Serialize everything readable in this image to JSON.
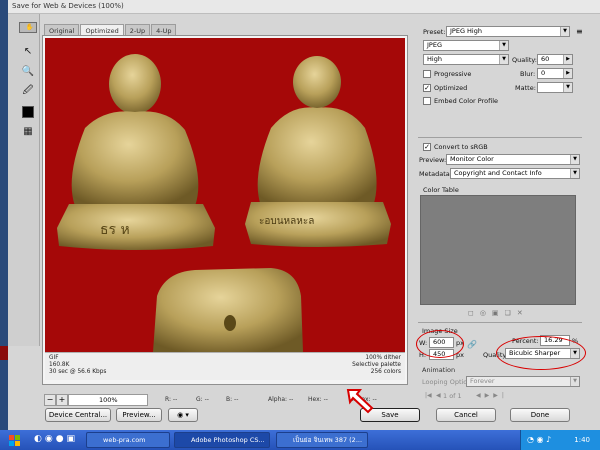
{
  "window": {
    "title": "Save for Web & Devices (100%)"
  },
  "tabs": [
    {
      "label": "Original"
    },
    {
      "label": "Optimized"
    },
    {
      "label": "2-Up"
    },
    {
      "label": "4-Up"
    }
  ],
  "preview_info": {
    "format": "GIF",
    "size": "160.8K",
    "time": "30 sec @ 56.6 Kbps",
    "dither": "100% dither",
    "palette": "Selective palette",
    "colors": "256 colors"
  },
  "bottom": {
    "zoom": "100%",
    "r_label": "R: --",
    "g_label": "G: --",
    "b_label": "B: --",
    "alpha_label": "Alpha: --",
    "hex_label": "Hex: --",
    "index_label": "Index: --"
  },
  "buttons": {
    "device_central": "Device Central...",
    "preview": "Preview...",
    "save": "Save",
    "cancel": "Cancel",
    "done": "Done"
  },
  "settings": {
    "preset_label": "Preset:",
    "preset_value": "JPEG High",
    "format_value": "JPEG",
    "quality_level": "High",
    "quality_label": "Quality:",
    "quality_value": "60",
    "progressive_label": "Progressive",
    "blur_label": "Blur:",
    "blur_value": "0",
    "optimized_label": "Optimized",
    "matte_label": "Matte:",
    "embed_profile_label": "Embed Color Profile",
    "convert_srgb_label": "Convert to sRGB",
    "preview_label": "Preview:",
    "preview_value": "Monitor Color",
    "metadata_label": "Metadata:",
    "metadata_value": "Copyright and Contact Info",
    "color_table_label": "Color Table"
  },
  "image_size": {
    "section_label": "Image Size",
    "w_label": "W:",
    "w_value": "600",
    "h_label": "H:",
    "h_value": "450",
    "unit": "px",
    "percent_label": "Percent:",
    "percent_value": "16.29",
    "percent_unit": "%",
    "quality_label": "Quality:",
    "quality_value": "Bicubic Sharper"
  },
  "animation": {
    "section_label": "Animation",
    "looping_label": "Looping Options:",
    "looping_value": "Forever",
    "frame_counter": "1 of 1"
  },
  "taskbar": {
    "items": [
      {
        "label": "web-pra.com"
      },
      {
        "label": "Adobe Photoshop CS..."
      },
      {
        "label": "เป็นย่อ จินเทพ 387 (2..."
      }
    ],
    "clock": "1:40"
  },
  "colors": {
    "accent_red": "#d80000",
    "canvas_red": "#a50808",
    "amulet_gold": "#b8a05a",
    "taskbar_blue": "#2552b8"
  }
}
